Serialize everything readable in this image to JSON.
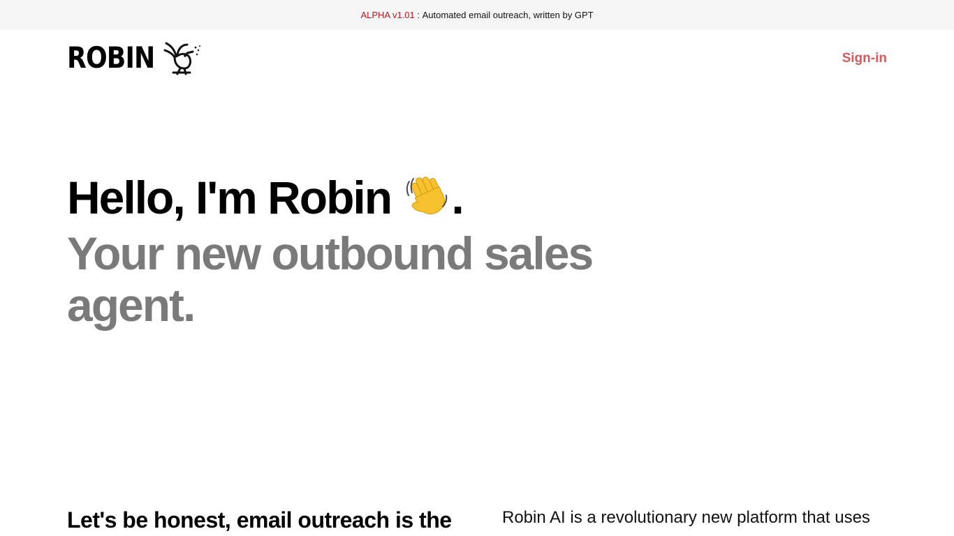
{
  "banner": {
    "badge": "ALPHA v1.01",
    "separator": " : ",
    "text": "Automated email outreach, written by GPT"
  },
  "header": {
    "logo_text": "ROBIN",
    "logo_icon": "bird-icon",
    "signin_label": "Sign-in"
  },
  "hero": {
    "line1": "Hello, I'm Robin",
    "wave_icon": "waving-hand-icon",
    "line1_end": ".",
    "line2": "Your new outbound sales agent."
  },
  "section": {
    "left_heading": "Let's be honest, email outreach is the",
    "right_text": "Robin AI is a revolutionary new platform that uses"
  },
  "colors": {
    "accent": "#d65a5f",
    "badge": "#c0141e",
    "muted": "#7a7a7a",
    "banner_bg": "#f6f6f6"
  }
}
